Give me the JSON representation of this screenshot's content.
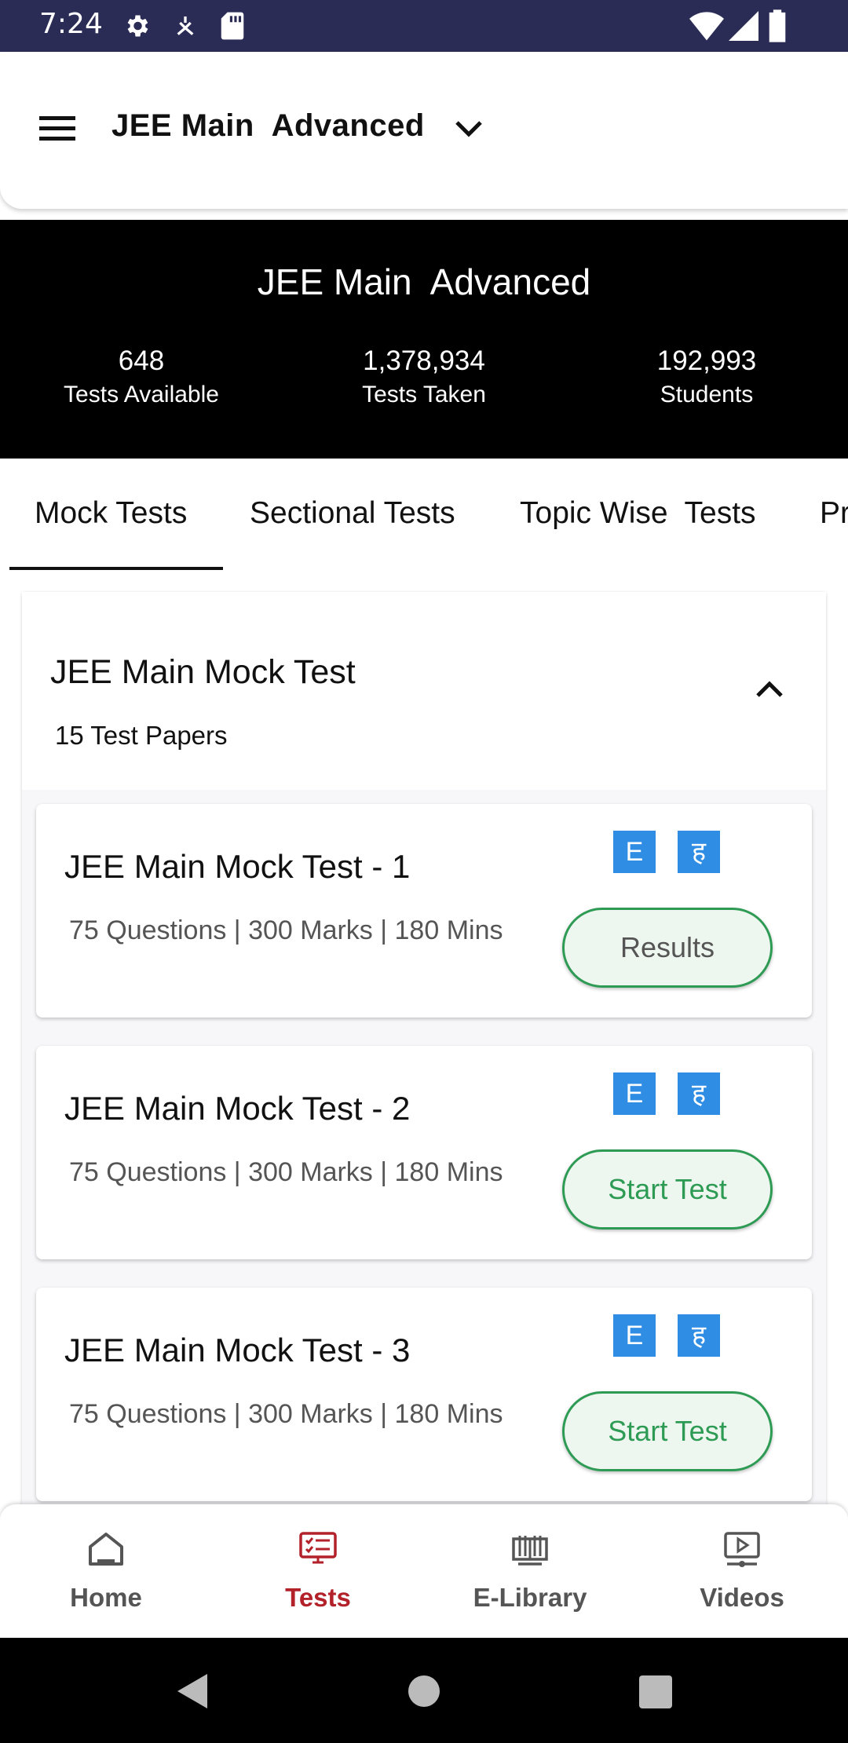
{
  "status_bar": {
    "time": "7:24",
    "icons": [
      "gear-icon",
      "location-icon",
      "sd-card-icon",
      "wifi-icon",
      "signal-icon",
      "battery-icon"
    ]
  },
  "app_bar": {
    "title": "JEE Main  Advanced",
    "menu_icon": "hamburger-icon",
    "dropdown_icon": "chevron-down-icon"
  },
  "hero": {
    "title": "JEE Main  Advanced",
    "stats": [
      {
        "value": "648",
        "label": "Tests Available"
      },
      {
        "value": "1,378,934",
        "label": "Tests Taken"
      },
      {
        "value": "192,993",
        "label": "Students"
      }
    ]
  },
  "tabs": [
    {
      "label": "Mock Tests",
      "active": true
    },
    {
      "label": "Sectional Tests",
      "active": false
    },
    {
      "label": "Topic Wise  Tests",
      "active": false
    },
    {
      "label": "Pr",
      "active": false
    }
  ],
  "section": {
    "title": "JEE Main Mock Test",
    "subtitle": "15 Test Papers",
    "collapse_icon": "chevron-up-icon",
    "tests": [
      {
        "name": "JEE Main Mock Test - 1",
        "meta": "75 Questions | 300 Marks | 180 Mins",
        "lang_en": "E",
        "lang_hi": "ह",
        "button": "Results"
      },
      {
        "name": "JEE Main Mock Test - 2",
        "meta": "75 Questions | 300 Marks | 180 Mins",
        "lang_en": "E",
        "lang_hi": "ह",
        "button": "Start Test"
      },
      {
        "name": "JEE Main Mock Test - 3",
        "meta": "75 Questions | 300 Marks | 180 Mins",
        "lang_en": "E",
        "lang_hi": "ह",
        "button": "Start Test"
      }
    ]
  },
  "bottom_nav": [
    {
      "label": "Home",
      "icon": "home-icon",
      "active": false
    },
    {
      "label": "Tests",
      "icon": "tests-icon",
      "active": true
    },
    {
      "label": "E-Library",
      "icon": "library-icon",
      "active": false
    },
    {
      "label": "Videos",
      "icon": "video-icon",
      "active": false
    }
  ],
  "colors": {
    "status_bar": "#2b2c55",
    "hero_bg": "#000000",
    "lang_badge": "#2f8de4",
    "button_green": "#2e9b55",
    "active_nav": "#b3222a"
  }
}
